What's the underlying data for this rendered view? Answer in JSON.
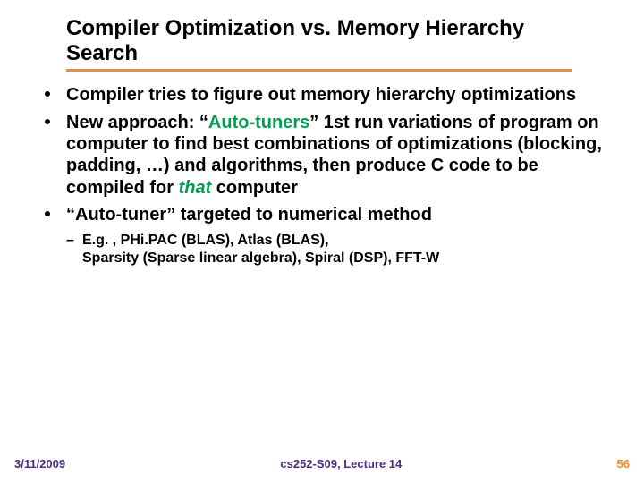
{
  "title": "Compiler Optimization vs. Memory Hierarchy Search",
  "bullets": [
    {
      "segments": [
        {
          "text": "Compiler tries to figure out memory hierarchy optimizations"
        }
      ]
    },
    {
      "segments": [
        {
          "text": "New approach: “"
        },
        {
          "text": "Auto-tuners",
          "highlight": true
        },
        {
          "text": "” 1st run variations of program on computer to find best combinations of optimizations (blocking, padding, …) and algorithms, then produce C code to be compiled for "
        },
        {
          "text": "that",
          "highlight": true,
          "italic": true
        },
        {
          "text": " computer"
        }
      ]
    },
    {
      "segments": [
        {
          "text": "“Auto-tuner” targeted to numerical method"
        }
      ],
      "sub": [
        "E.g. , PHi.PAC (BLAS), Atlas (BLAS),",
        "Sparsity (Sparse linear algebra), Spiral (DSP), FFT-W"
      ]
    }
  ],
  "footer": {
    "date": "3/11/2009",
    "center": "cs252-S09, Lecture 14",
    "page": "56"
  }
}
